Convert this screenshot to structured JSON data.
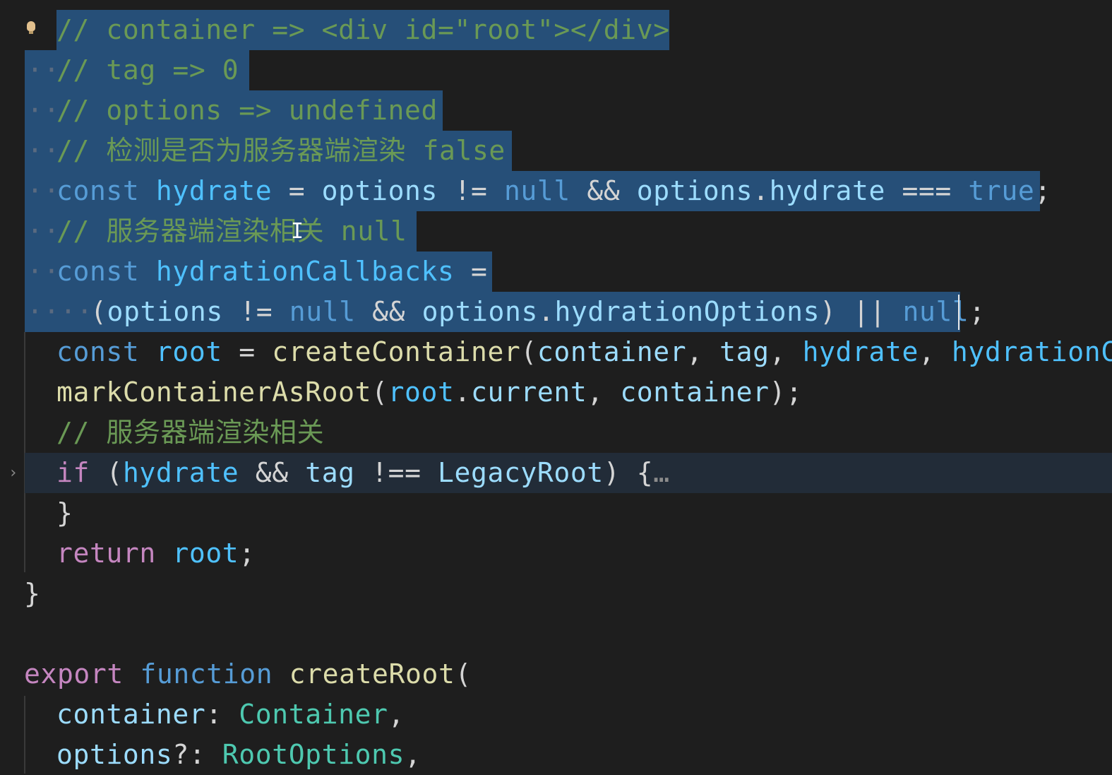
{
  "editor": {
    "lines": [
      {
        "id": "l1",
        "text": "// container => <div id=\"root\"></div>"
      },
      {
        "id": "l2",
        "text": "// tag => 0"
      },
      {
        "id": "l3",
        "text": "// options => undefined"
      },
      {
        "id": "l4",
        "text": "// 检测是否为服务器端渲染 false"
      },
      {
        "id": "l5",
        "text": "const hydrate = options != null && options.hydrate === true;"
      },
      {
        "id": "l6",
        "text": "// 服务器端渲染相关 null"
      },
      {
        "id": "l7",
        "text": "const hydrationCallbacks ="
      },
      {
        "id": "l8",
        "text": "(options != null && options.hydrationOptions) || null;"
      },
      {
        "id": "l9",
        "text": "const root = createContainer(container, tag, hydrate, hydrationCa"
      },
      {
        "id": "l10",
        "text": "markContainerAsRoot(root.current, container);"
      },
      {
        "id": "l11",
        "text": "// 服务器端渲染相关"
      },
      {
        "id": "l12",
        "text": "if (hydrate && tag !== LegacyRoot) {…"
      },
      {
        "id": "l13",
        "text": "}"
      },
      {
        "id": "l14",
        "text": "return root;"
      },
      {
        "id": "l15",
        "text": "}"
      },
      {
        "id": "l16",
        "text": ""
      },
      {
        "id": "l17",
        "text": "export function createRoot("
      },
      {
        "id": "l18",
        "text": "container: Container,"
      },
      {
        "id": "l19",
        "text": "options?: RootOptions,"
      }
    ],
    "tokens": {
      "l1": [
        [
          "c-com",
          "// container => <div id=\"root\"></div>"
        ]
      ],
      "l2": [
        [
          "c-com",
          "// tag => 0"
        ]
      ],
      "l3": [
        [
          "c-com",
          "// options => undefined"
        ]
      ],
      "l4": [
        [
          "c-com",
          "// 检测是否为服务器端渲染 false"
        ]
      ],
      "l5": [
        [
          "c-kw",
          "const "
        ],
        [
          "c-var",
          "hydrate"
        ],
        [
          "c-op",
          " = "
        ],
        [
          "c-id",
          "options"
        ],
        [
          "c-op",
          " != "
        ],
        [
          "c-kw",
          "null"
        ],
        [
          "c-op",
          " && "
        ],
        [
          "c-id",
          "options"
        ],
        [
          "c-op",
          "."
        ],
        [
          "c-id",
          "hydrate"
        ],
        [
          "c-op",
          " === "
        ],
        [
          "c-kw",
          "true"
        ],
        [
          "c-op",
          ";"
        ]
      ],
      "l6": [
        [
          "c-com",
          "// 服务器端渲染相关 null"
        ]
      ],
      "l7": [
        [
          "c-kw",
          "const "
        ],
        [
          "c-var",
          "hydrationCallbacks"
        ],
        [
          "c-op",
          " ="
        ]
      ],
      "l8": [
        [
          "c-op",
          "("
        ],
        [
          "c-id",
          "options"
        ],
        [
          "c-op",
          " != "
        ],
        [
          "c-kw",
          "null"
        ],
        [
          "c-op",
          " && "
        ],
        [
          "c-id",
          "options"
        ],
        [
          "c-op",
          "."
        ],
        [
          "c-id",
          "hydrationOptions"
        ],
        [
          "c-op",
          ") || "
        ],
        [
          "c-kw",
          "null"
        ],
        [
          "c-op",
          ";"
        ]
      ],
      "l9": [
        [
          "c-kw",
          "const "
        ],
        [
          "c-var",
          "root"
        ],
        [
          "c-op",
          " = "
        ],
        [
          "c-fn",
          "createContainer"
        ],
        [
          "c-op",
          "("
        ],
        [
          "c-id",
          "container"
        ],
        [
          "c-op",
          ", "
        ],
        [
          "c-id",
          "tag"
        ],
        [
          "c-op",
          ", "
        ],
        [
          "c-var",
          "hydrate"
        ],
        [
          "c-op",
          ", "
        ],
        [
          "c-var",
          "hydrationCa"
        ]
      ],
      "l10": [
        [
          "c-fn",
          "markContainerAsRoot"
        ],
        [
          "c-op",
          "("
        ],
        [
          "c-var",
          "root"
        ],
        [
          "c-op",
          "."
        ],
        [
          "c-id",
          "current"
        ],
        [
          "c-op",
          ", "
        ],
        [
          "c-id",
          "container"
        ],
        [
          "c-op",
          ");"
        ]
      ],
      "l11": [
        [
          "c-com",
          "// 服务器端渲染相关"
        ]
      ],
      "l12": [
        [
          "c-kw2",
          "if"
        ],
        [
          "c-op",
          " ("
        ],
        [
          "c-var",
          "hydrate"
        ],
        [
          "c-op",
          " && "
        ],
        [
          "c-id",
          "tag"
        ],
        [
          "c-op",
          " !== "
        ],
        [
          "c-id",
          "LegacyRoot"
        ],
        [
          "c-op",
          ") {"
        ],
        [
          "c-fold",
          "…"
        ]
      ],
      "l13": [
        [
          "c-op",
          "}"
        ]
      ],
      "l14": [
        [
          "c-kw2",
          "return "
        ],
        [
          "c-var",
          "root"
        ],
        [
          "c-op",
          ";"
        ]
      ],
      "l15": [
        [
          "c-op",
          "}"
        ]
      ],
      "l16": [],
      "l17": [
        [
          "c-kw2",
          "export "
        ],
        [
          "c-kw",
          "function "
        ],
        [
          "c-fn",
          "createRoot"
        ],
        [
          "c-op",
          "("
        ]
      ],
      "l18": [
        [
          "c-id",
          "container"
        ],
        [
          "c-op",
          ": "
        ],
        [
          "c-ty",
          "Container"
        ],
        [
          "c-op",
          ","
        ]
      ],
      "l19": [
        [
          "c-id",
          "options"
        ],
        [
          "c-op",
          "?: "
        ],
        [
          "c-ty",
          "RootOptions"
        ],
        [
          "c-op",
          ","
        ]
      ]
    },
    "fold_marker": "›",
    "ibeam_glyph": "I",
    "colors": {
      "background": "#1e1e1e",
      "selection": "#264f78",
      "comment": "#6a9955",
      "keyword": "#569cd6",
      "control_keyword": "#c586c0",
      "variable": "#4fc1ff",
      "identifier": "#9cdcfe",
      "function": "#dcdcaa",
      "type": "#4ec9b0"
    }
  }
}
